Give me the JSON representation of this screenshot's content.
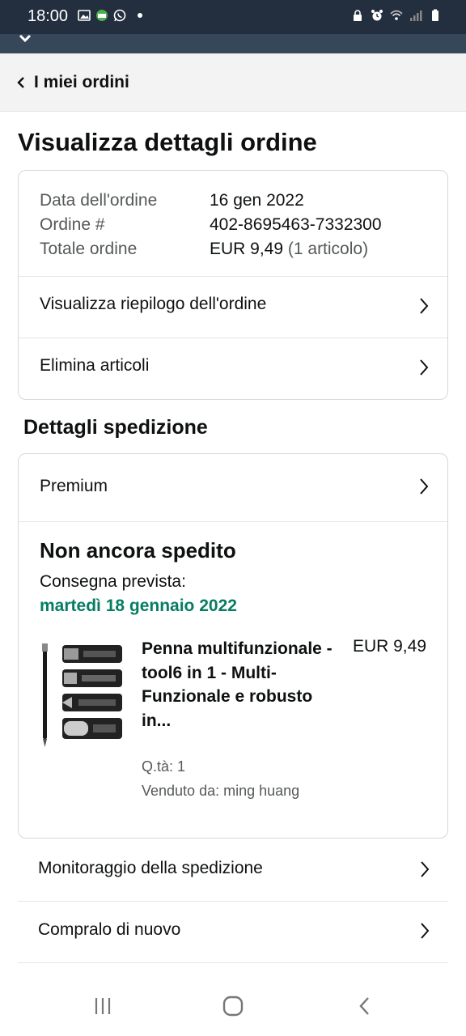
{
  "status_bar": {
    "time": "18:00"
  },
  "header": {
    "back_label": "I miei ordini"
  },
  "page": {
    "title": "Visualizza dettagli ordine"
  },
  "order_info": {
    "rows": [
      {
        "label": "Data dell'ordine",
        "value": "16 gen 2022",
        "extra": ""
      },
      {
        "label": "Ordine #",
        "value": "402-8695463-7332300",
        "extra": ""
      },
      {
        "label": "Totale ordine",
        "value": "EUR 9,49",
        "extra": " (1 articolo)"
      }
    ],
    "links": [
      {
        "label": "Visualizza riepilogo dell'ordine"
      },
      {
        "label": "Elimina articoli"
      }
    ]
  },
  "shipping": {
    "section_title": "Dettagli spedizione",
    "method": "Premium",
    "status": "Non ancora spedito",
    "eta_label": "Consegna prevista:",
    "eta_date": "martedì 18 gennaio 2022",
    "product": {
      "title": "Penna multifunzionale - tool6 in 1 - Multi-Funzionale e robusto in...",
      "price": "EUR 9,49",
      "qty": "Q.tà: 1",
      "seller": "Venduto da: ming huang"
    }
  },
  "actions": [
    {
      "label": "Monitoraggio della spedizione"
    },
    {
      "label": "Compralo di nuovo"
    }
  ],
  "colors": {
    "header_bg": "#232f3e",
    "delivery_green": "#067d62"
  }
}
